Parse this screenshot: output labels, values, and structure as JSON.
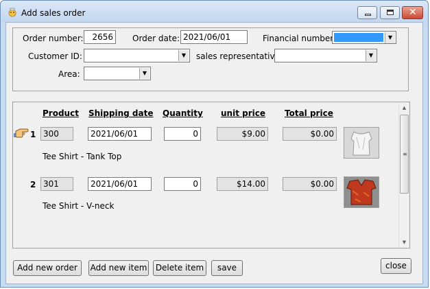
{
  "window": {
    "title": "Add sales order"
  },
  "header": {
    "order_number_label": "Order number:",
    "order_number_value": "2656",
    "order_date_label": "Order date:",
    "order_date_value": "2021/06/01",
    "financial_number_label": "Financial number:",
    "financial_number_value": "",
    "customer_id_label": "Customer ID:",
    "customer_id_value": "",
    "sales_rep_label": "sales representative:",
    "sales_rep_value": "",
    "area_label": "Area:",
    "area_value": ""
  },
  "grid": {
    "columns": {
      "product": "Product",
      "shipping_date": "Shipping date",
      "quantity": "Quantity",
      "unit_price": "unit price",
      "total_price": "Total price"
    },
    "rows": [
      {
        "num": "1",
        "product": "300",
        "shipping_date": "2021/06/01",
        "quantity": "0",
        "unit_price": "$9.00",
        "total_price": "$0.00",
        "description": "Tee Shirt - Tank Top",
        "image": "white-tank-top-image",
        "current": true
      },
      {
        "num": "2",
        "product": "301",
        "shipping_date": "2021/06/01",
        "quantity": "0",
        "unit_price": "$14.00",
        "total_price": "$0.00",
        "description": "Tee Shirt - V-neck",
        "image": "red-vneck-image",
        "current": false
      }
    ]
  },
  "buttons": {
    "add_order": "Add new order",
    "add_item": "Add new item",
    "delete_item": "Delete item",
    "save": "save",
    "close": "close"
  },
  "colors": {
    "selection": "#3399ff",
    "window_frame": "#c7dbf1"
  }
}
